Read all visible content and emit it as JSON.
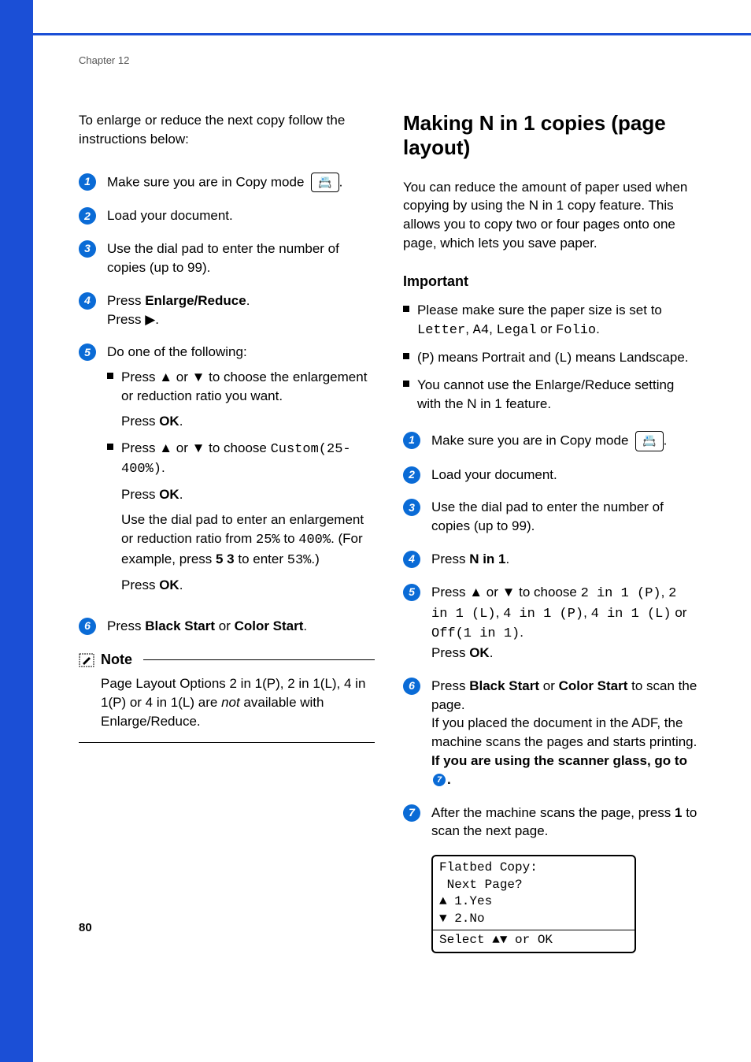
{
  "chapter": "Chapter 12",
  "page_number": "80",
  "left": {
    "intro": "To enlarge or reduce the next copy follow the instructions below:",
    "steps": {
      "s1": "Make sure you are in Copy mode ",
      "s2": "Load your document.",
      "s3": "Use the dial pad to enter the number of copies (up to 99).",
      "s4a": "Press ",
      "s4b": "Enlarge/Reduce",
      "s4c": ".",
      "s4d": "Press ",
      "s4e": "▶",
      "s4f": ".",
      "s5": "Do one of the following:",
      "s5_b1a": "Press ",
      "s5_b1b": "▲",
      "s5_b1c": " or ",
      "s5_b1d": "▼",
      "s5_b1e": " to choose the enlargement or reduction ratio you want.",
      "s5_b1_ok": "Press ",
      "s5_b1_okb": "OK",
      "s5_b1_okc": ".",
      "s5_b2a": "Press ",
      "s5_b2b": "▲",
      "s5_b2c": " or ",
      "s5_b2d": "▼",
      "s5_b2e": " to choose ",
      "s5_b2f": "Custom(25-400%)",
      "s5_b2g": ".",
      "s5_b2_ok": "Press ",
      "s5_b2_okb": "OK",
      "s5_b2_okc": ".",
      "s5_b2_p2a": "Use the dial pad to enter an enlargement or reduction ratio from ",
      "s5_b2_p2b": "25%",
      "s5_b2_p2c": " to ",
      "s5_b2_p2d": "400%",
      "s5_b2_p2e": ". (For example, press ",
      "s5_b2_p2f": "5 3",
      "s5_b2_p2g": " to enter ",
      "s5_b2_p2h": "53%",
      "s5_b2_p2i": ".)",
      "s5_b2_ok2": "Press ",
      "s5_b2_ok2b": "OK",
      "s5_b2_ok2c": ".",
      "s6a": "Press ",
      "s6b": "Black Start",
      "s6c": " or ",
      "s6d": "Color Start",
      "s6e": "."
    },
    "note": {
      "title": "Note",
      "body_a": "Page Layout Options 2 in 1(P), 2 in 1(L), 4 in 1(P) or 4 in 1(L) are ",
      "body_b": "not",
      "body_c": " available with Enlarge/Reduce."
    }
  },
  "right": {
    "heading": "Making N in 1 copies (page layout)",
    "intro": "You can reduce the amount of paper used when copying by using the N in 1 copy feature. This allows you to copy two or four pages onto one page, which lets you save paper.",
    "important_label": "Important",
    "important": {
      "b1a": "Please make sure the paper size is set to ",
      "b1b": "Letter",
      "b1c": ", ",
      "b1d": "A4",
      "b1e": ", ",
      "b1f": "Legal",
      "b1g": " or ",
      "b1h": "Folio",
      "b1i": ".",
      "b2a": "(",
      "b2b": "P",
      "b2c": ") means Portrait and (",
      "b2d": "L",
      "b2e": ") means Landscape.",
      "b3": "You cannot use the Enlarge/Reduce setting with the N in 1 feature."
    },
    "steps": {
      "s1": "Make sure you are in Copy mode ",
      "s2": "Load your document.",
      "s3": "Use the dial pad to enter the number of copies (up to 99).",
      "s4a": "Press ",
      "s4b": "N in 1",
      "s4c": ".",
      "s5a": "Press ",
      "s5b": "▲",
      "s5c": " or ",
      "s5d": "▼",
      "s5e": " to choose ",
      "s5f": "2 in 1 (P)",
      "s5g": ", ",
      "s5h": "2 in 1 (L)",
      "s5i": ", ",
      "s5j": "4 in 1 (P)",
      "s5k": ", ",
      "s5l": "4 in 1 (L)",
      "s5m": " or ",
      "s5n": "Off(1 in 1)",
      "s5o": ".",
      "s5p": "Press ",
      "s5q": "OK",
      "s5r": ".",
      "s6a": "Press ",
      "s6b": "Black Start",
      "s6c": " or ",
      "s6d": "Color Start",
      "s6e": " to scan the page.",
      "s6f": "If you placed the document in the ADF, the machine scans the pages and starts printing.",
      "s6g": "If you are using the scanner glass, go to ",
      "s6h": ".",
      "s7a": "After the machine scans the page, press ",
      "s7b": "1",
      "s7c": " to scan the next page."
    },
    "lcd": {
      "l1": "Flatbed Copy:",
      "l2": " Next Page?",
      "l3": "▲ 1.Yes",
      "l4": "▼ 2.No",
      "l5": "Select ▲▼ or OK"
    }
  }
}
